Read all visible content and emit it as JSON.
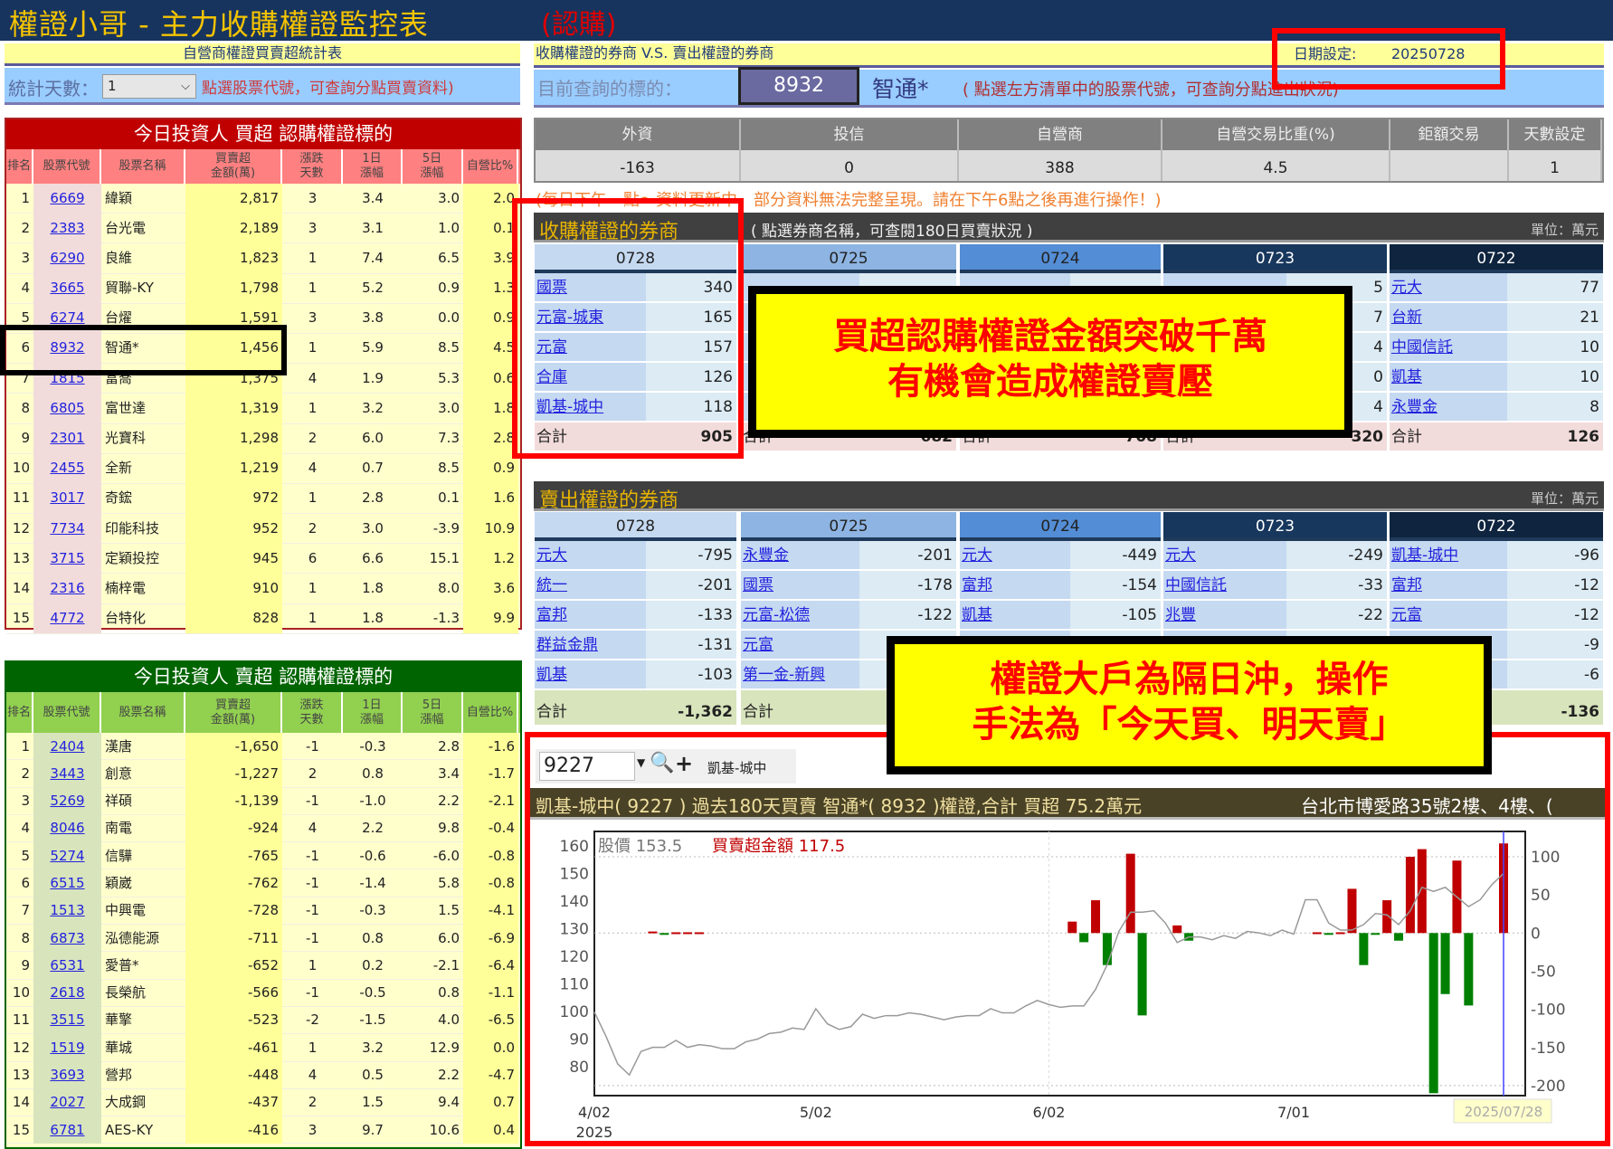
{
  "header": {
    "title": "權證小哥 - 主力收購權證監控表",
    "tag": "(認購)"
  },
  "left": {
    "section_title": "自營商權證買賣超統計表",
    "days_label": "統計天數：",
    "days_value": "1",
    "hint": "點選股票代號，可查詢分點買賣資料)",
    "columns": [
      "排名",
      "股票代號",
      "股票名稱",
      "買賣超\n金額(萬)",
      "漲跌\n天數",
      "1日\n漲幅",
      "5日\n漲幅",
      "自營比%"
    ],
    "buy_table": {
      "title": "今日投資人 買超 認購權證標的",
      "rows": [
        [
          "1",
          "6669",
          "緯穎",
          "2,817",
          "3",
          "3.4",
          "3.0",
          "2.0"
        ],
        [
          "2",
          "2383",
          "台光電",
          "2,189",
          "3",
          "3.1",
          "1.0",
          "0.1"
        ],
        [
          "3",
          "6290",
          "良維",
          "1,823",
          "1",
          "7.4",
          "6.5",
          "3.9"
        ],
        [
          "4",
          "3665",
          "貿聯-KY",
          "1,798",
          "1",
          "5.2",
          "0.9",
          "1.3"
        ],
        [
          "5",
          "6274",
          "台燿",
          "1,591",
          "3",
          "3.8",
          "0.0",
          "0.9"
        ],
        [
          "6",
          "8932",
          "智通*",
          "1,456",
          "1",
          "5.9",
          "8.5",
          "4.5"
        ],
        [
          "7",
          "1815",
          "富喬",
          "1,375",
          "4",
          "1.9",
          "5.3",
          "0.6"
        ],
        [
          "8",
          "6805",
          "富世達",
          "1,319",
          "1",
          "3.2",
          "3.0",
          "1.8"
        ],
        [
          "9",
          "2301",
          "光寶科",
          "1,298",
          "2",
          "6.0",
          "7.3",
          "2.8"
        ],
        [
          "10",
          "2455",
          "全新",
          "1,219",
          "4",
          "0.7",
          "8.5",
          "0.9"
        ],
        [
          "11",
          "3017",
          "奇鋐",
          "972",
          "1",
          "2.8",
          "0.1",
          "1.6"
        ],
        [
          "12",
          "7734",
          "印能科技",
          "952",
          "2",
          "3.0",
          "-3.9",
          "10.9"
        ],
        [
          "13",
          "3715",
          "定穎投控",
          "945",
          "6",
          "6.6",
          "15.1",
          "1.2"
        ],
        [
          "14",
          "2316",
          "楠梓電",
          "910",
          "1",
          "1.8",
          "8.0",
          "3.6"
        ],
        [
          "15",
          "4772",
          "台特化",
          "828",
          "1",
          "1.8",
          "-1.3",
          "9.9"
        ]
      ]
    },
    "sell_table": {
      "title": "今日投資人 賣超 認購權證標的",
      "rows": [
        [
          "1",
          "2404",
          "漢唐",
          "-1,650",
          "-1",
          "-0.3",
          "2.8",
          "-1.6"
        ],
        [
          "2",
          "3443",
          "創意",
          "-1,227",
          "2",
          "0.8",
          "3.4",
          "-1.7"
        ],
        [
          "3",
          "5269",
          "祥碩",
          "-1,139",
          "-1",
          "-1.0",
          "2.2",
          "-2.1"
        ],
        [
          "4",
          "8046",
          "南電",
          "-924",
          "4",
          "2.2",
          "9.8",
          "-0.4"
        ],
        [
          "5",
          "5274",
          "信驊",
          "-765",
          "-1",
          "-0.6",
          "-6.0",
          "-0.8"
        ],
        [
          "6",
          "6515",
          "穎崴",
          "-762",
          "-1",
          "-1.4",
          "5.8",
          "-0.8"
        ],
        [
          "7",
          "1513",
          "中興電",
          "-728",
          "-1",
          "-0.3",
          "1.5",
          "-4.1"
        ],
        [
          "8",
          "6873",
          "泓德能源",
          "-711",
          "-1",
          "0.8",
          "6.0",
          "-6.9"
        ],
        [
          "9",
          "6531",
          "愛普*",
          "-652",
          "1",
          "0.2",
          "-2.1",
          "-6.4"
        ],
        [
          "10",
          "2618",
          "長榮航",
          "-566",
          "-1",
          "-0.5",
          "0.8",
          "-1.1"
        ],
        [
          "11",
          "3515",
          "華擎",
          "-523",
          "-2",
          "-1.5",
          "4.0",
          "-6.5"
        ],
        [
          "12",
          "1519",
          "華城",
          "-461",
          "1",
          "3.2",
          "12.9",
          "0.0"
        ],
        [
          "13",
          "3693",
          "營邦",
          "-448",
          "4",
          "0.5",
          "2.2",
          "-4.7"
        ],
        [
          "14",
          "2027",
          "大成鋼",
          "-437",
          "2",
          "1.5",
          "9.4",
          "0.7"
        ],
        [
          "15",
          "6781",
          "AES-KY",
          "-416",
          "3",
          "9.7",
          "10.6",
          "0.4"
        ]
      ]
    }
  },
  "right": {
    "section_title": "收購權證的券商 V.S. 賣出權證的券商",
    "date_label": "日期設定:",
    "date_value": "20250728",
    "query_label": "目前查詢的標的：",
    "query_code": "8932",
    "query_name": "智通*",
    "query_hint": "( 點選左方清單中的股票代號，可查詢分點進出狀況)",
    "stats": {
      "headers": [
        "外資",
        "投信",
        "自營商",
        "自營交易比重(%)",
        "鉅額交易",
        "天數設定"
      ],
      "values": [
        "-163",
        "0",
        "388",
        "4.5",
        "",
        "1"
      ]
    },
    "notice": "(每日下午一點～資料更新中，部分資料無法完整呈現。請在下午6點之後再進行操作！)",
    "buy_brokers": {
      "title": "收購權證的券商",
      "hint": "( 點選券商名稱，可查閱180日買賣狀況 )",
      "unit": "單位：萬元",
      "columns": [
        {
          "date": "0728",
          "rows": [
            [
              "國票",
              "340"
            ],
            [
              "元富-城東",
              "165"
            ],
            [
              "元富",
              "157"
            ],
            [
              "合庫",
              "126"
            ],
            [
              "凱基-城中",
              "118"
            ]
          ],
          "total_label": "合計",
          "total": "905"
        },
        {
          "date": "0725",
          "rows": [
            [
              "",
              ""
            ],
            [
              "",
              ""
            ],
            [
              "",
              ""
            ],
            [
              "",
              ""
            ],
            [
              "",
              ""
            ]
          ],
          "total_label": "合計",
          "total": "682"
        },
        {
          "date": "0724",
          "rows": [
            [
              "",
              ""
            ],
            [
              "",
              ""
            ],
            [
              "",
              ""
            ],
            [
              "",
              ""
            ],
            [
              "",
              ""
            ]
          ],
          "total_label": "合計",
          "total": "708"
        },
        {
          "date": "0723",
          "rows": [
            [
              "",
              "5"
            ],
            [
              "",
              "7"
            ],
            [
              "",
              "4"
            ],
            [
              "",
              "0"
            ],
            [
              "",
              "4"
            ]
          ],
          "total_label": "合計",
          "total": "320"
        },
        {
          "date": "0722",
          "rows": [
            [
              "元大",
              "77"
            ],
            [
              "台新",
              "21"
            ],
            [
              "中國信託",
              "10"
            ],
            [
              "凱基",
              "10"
            ],
            [
              "永豐金",
              "8"
            ]
          ],
          "total_label": "合計",
          "total": "126"
        }
      ]
    },
    "sell_brokers": {
      "title": "賣出權證的券商",
      "unit": "單位：萬元",
      "columns": [
        {
          "date": "0728",
          "rows": [
            [
              "元大",
              "-795"
            ],
            [
              "統一",
              "-201"
            ],
            [
              "富邦",
              "-133"
            ],
            [
              "群益金鼎",
              "-131"
            ],
            [
              "凱基",
              "-103"
            ]
          ],
          "total_label": "合計",
          "total": "-1,362"
        },
        {
          "date": "0725",
          "rows": [
            [
              "永豐金",
              "-201"
            ],
            [
              "國票",
              "-178"
            ],
            [
              "元富-松德",
              "-122"
            ],
            [
              "元富",
              ""
            ],
            [
              "第一金-新興",
              ""
            ]
          ],
          "total_label": "合計",
          "total": ""
        },
        {
          "date": "0724",
          "rows": [
            [
              "元大",
              "-449"
            ],
            [
              "富邦",
              "-154"
            ],
            [
              "凱基",
              "-105"
            ],
            [
              "",
              ""
            ],
            [
              "",
              ""
            ]
          ],
          "total_label": "",
          "total": ""
        },
        {
          "date": "0723",
          "rows": [
            [
              "元大",
              "-249"
            ],
            [
              "中國信託",
              "-33"
            ],
            [
              "兆豐",
              "-22"
            ],
            [
              "",
              ""
            ],
            [
              "",
              ""
            ]
          ],
          "total_label": "",
          "total": ""
        },
        {
          "date": "0722",
          "rows": [
            [
              "凱基-城中",
              "-96"
            ],
            [
              "富邦",
              "-12"
            ],
            [
              "元富",
              "-12"
            ],
            [
              "",
              "-9"
            ],
            [
              "",
              "-6"
            ]
          ],
          "total_label": "",
          "total": "-136"
        }
      ]
    },
    "broker_search": {
      "code": "9227",
      "name": "凱基-城中"
    },
    "chart_title": "凱基-城中( 9227 ) 過去180天買賣 智通*( 8932 )權證,合計  買超 75.2萬元",
    "chart_address": "台北市博愛路35號2樓、4樓、("
  },
  "annotations": {
    "box1": [
      "買超認購權證金額突破千萬",
      "有機會造成權證賣壓"
    ],
    "box2": [
      "權證大戶為隔日沖，操作",
      "手法為「今天買、明天賣」"
    ]
  },
  "colors": {
    "buy_bar": "#c00000",
    "sell_bar": "#008000",
    "price_line": "#999999",
    "cursor": "#4444ff"
  },
  "chart_data": {
    "type": "bar+line",
    "price_label": "股價 153.5",
    "amount_label": "買賣超金額 117.5",
    "left_axis": {
      "label": "股價",
      "range": [
        75,
        163
      ],
      "ticks": [
        "160",
        "150",
        "140",
        "130",
        "120",
        "110",
        "100",
        "90",
        "80"
      ]
    },
    "right_axis": {
      "label": "買賣超金額",
      "range": [
        -210,
        115
      ],
      "ticks": [
        "100",
        "50",
        "0",
        "-50",
        "-100",
        "-150",
        "-200"
      ]
    },
    "x_ticks": [
      {
        "i": 0,
        "label": "4/02"
      },
      {
        "i": 19,
        "label": "5/02"
      },
      {
        "i": 39,
        "label": "6/02"
      },
      {
        "i": 60,
        "label": "7/01"
      }
    ],
    "x_year": "2025",
    "cursor_label": "2025/07/28",
    "cursor_index": 78,
    "price": [
      99.8,
      91,
      81,
      77,
      85.5,
      87,
      87,
      89.5,
      87,
      88,
      87.5,
      86.5,
      86.5,
      89,
      90,
      92,
      92.5,
      94,
      93.5,
      101,
      95.5,
      93.5,
      94.5,
      99,
      97.5,
      98.5,
      98.5,
      99.5,
      99,
      98,
      97,
      98,
      98.5,
      98.5,
      101,
      99.5,
      99.5,
      102,
      104,
      102.5,
      101.5,
      102,
      102,
      108,
      117,
      129,
      136,
      136,
      136.5,
      132,
      125,
      127,
      127,
      126,
      127.5,
      126.5,
      129,
      128.5,
      127.5,
      129.5,
      128,
      140.5,
      140.5,
      132,
      129.5,
      129.5,
      131.5,
      135.5,
      135,
      131.5,
      136.5,
      145,
      143.5,
      145,
      141.5,
      138,
      140.5,
      146,
      150
    ],
    "amount": [
      [
        5,
        2
      ],
      [
        6,
        -2
      ],
      [
        7,
        1
      ],
      [
        8,
        1
      ],
      [
        9,
        1
      ],
      [
        41,
        15
      ],
      [
        42,
        -12
      ],
      [
        43,
        43
      ],
      [
        44,
        -42
      ],
      [
        46,
        104
      ],
      [
        47,
        -108
      ],
      [
        50,
        10
      ],
      [
        51,
        -10
      ],
      [
        62,
        1
      ],
      [
        63,
        -1
      ],
      [
        64,
        1
      ],
      [
        65,
        58
      ],
      [
        66,
        -42
      ],
      [
        67,
        -1
      ],
      [
        68,
        43
      ],
      [
        69,
        -10
      ],
      [
        70,
        100
      ],
      [
        71,
        110
      ],
      [
        72,
        -210
      ],
      [
        73,
        -80
      ],
      [
        74,
        95
      ],
      [
        75,
        -95
      ],
      [
        78,
        117.5
      ]
    ]
  }
}
